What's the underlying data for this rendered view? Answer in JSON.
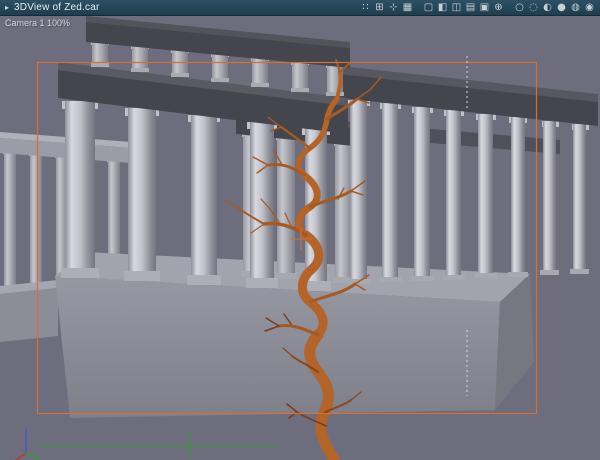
{
  "window": {
    "menu_glyph": "▸",
    "title": "3DView of Zed.car"
  },
  "titlebar_icons": [
    {
      "name": "snap-grid-icon",
      "glyph": "∷"
    },
    {
      "name": "add-object-icon",
      "glyph": "⊞"
    },
    {
      "name": "axes-icon",
      "glyph": "⊹"
    },
    {
      "name": "grid-display-icon",
      "glyph": "▦"
    },
    {
      "name": "wireframe-view-icon",
      "glyph": "▢"
    },
    {
      "name": "half-shaded-view-icon",
      "glyph": "◧"
    },
    {
      "name": "split-view-icon",
      "glyph": "◫"
    },
    {
      "name": "hatched-view-icon",
      "glyph": "▤"
    },
    {
      "name": "solid-view-icon",
      "glyph": "▣"
    },
    {
      "name": "light-icon",
      "glyph": "⊕"
    },
    {
      "name": "wire-sphere-icon",
      "glyph": "○"
    },
    {
      "name": "dashed-sphere-icon",
      "glyph": "◌"
    },
    {
      "name": "half-sphere-icon",
      "glyph": "◐"
    },
    {
      "name": "solid-sphere-icon",
      "glyph": "●"
    },
    {
      "name": "material-sphere-icon",
      "glyph": "◍"
    },
    {
      "name": "render-sphere-icon",
      "glyph": "◉"
    }
  ],
  "viewport": {
    "camera_label": "Camera 1 100%"
  },
  "colors": {
    "titlebar_bg_top": "#2c5064",
    "titlebar_bg_bottom": "#203d4e",
    "titlebar_text": "#e9eff3",
    "icon_color": "#c6cfd6",
    "viewport_bg": "#6d6d7e",
    "camera_frame": "#d2703a",
    "slab_dark": "#45454e",
    "base_gray": "#8f8f9a",
    "column_light": "#d8d8e0",
    "tree_trunk": "#b2642a",
    "tree_branch": "#a55a26",
    "tree_twig": "#7a3b1a",
    "axis_green": "#2f9e2f",
    "axis_red": "#c23535",
    "axis_blue": "#4656cc",
    "dashed_line": "#d8d8e0",
    "camera_label_text": "#d6d6de"
  }
}
